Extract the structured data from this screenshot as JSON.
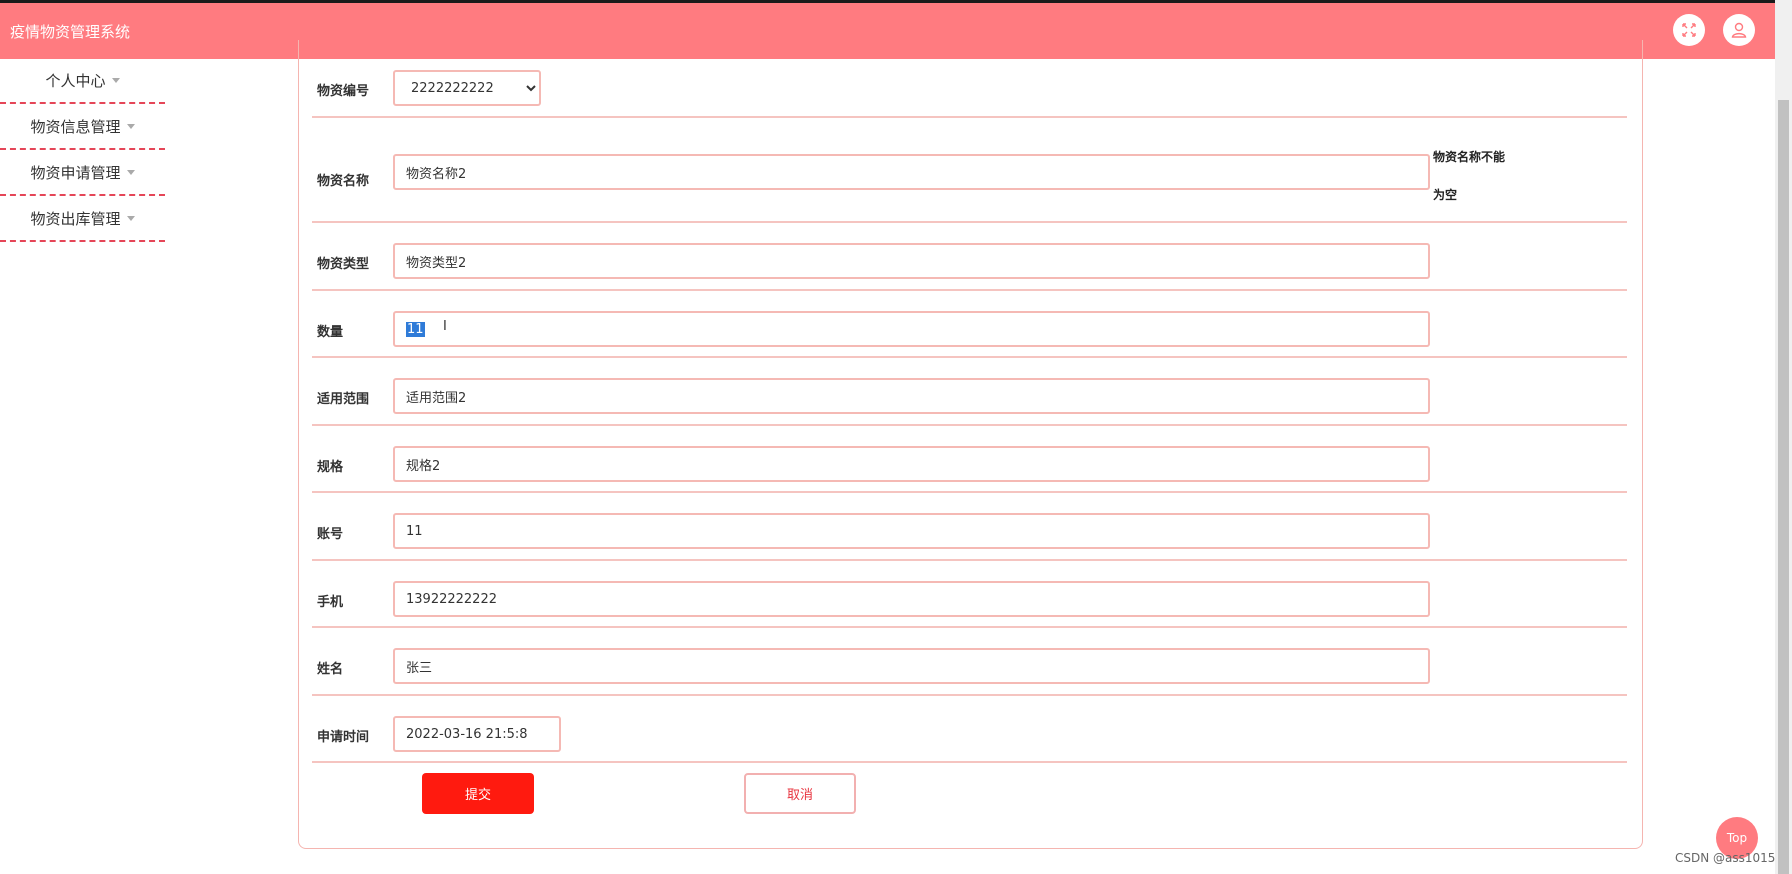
{
  "app": {
    "title": "疫情物资管理系统"
  },
  "sidebar": {
    "items": [
      {
        "label": "个人中心"
      },
      {
        "label": "物资信息管理"
      },
      {
        "label": "物资申请管理"
      },
      {
        "label": "物资出库管理"
      }
    ]
  },
  "form": {
    "fields": {
      "code": {
        "label": "物资编号",
        "value": "2222222222"
      },
      "name": {
        "label": "物资名称",
        "value": "物资名称2",
        "error": "物资名称不能为空"
      },
      "type": {
        "label": "物资类型",
        "value": "物资类型2"
      },
      "quantity": {
        "label": "数量",
        "value": "11"
      },
      "scope": {
        "label": "适用范围",
        "value": "适用范围2"
      },
      "spec": {
        "label": "规格",
        "value": "规格2"
      },
      "account": {
        "label": "账号",
        "value": "11"
      },
      "phone": {
        "label": "手机",
        "value": "13922222222"
      },
      "username": {
        "label": "姓名",
        "value": "张三"
      },
      "apply_time": {
        "label": "申请时间",
        "value": "2022-03-16 21:5:8"
      }
    },
    "submit_label": "提交",
    "cancel_label": "取消"
  },
  "back_to_top": "Top",
  "watermark": "CSDN @ass1015",
  "colors": {
    "header": "#ff7b80",
    "submit": "#ff1a0f",
    "input_border": "#f5b9b4"
  }
}
